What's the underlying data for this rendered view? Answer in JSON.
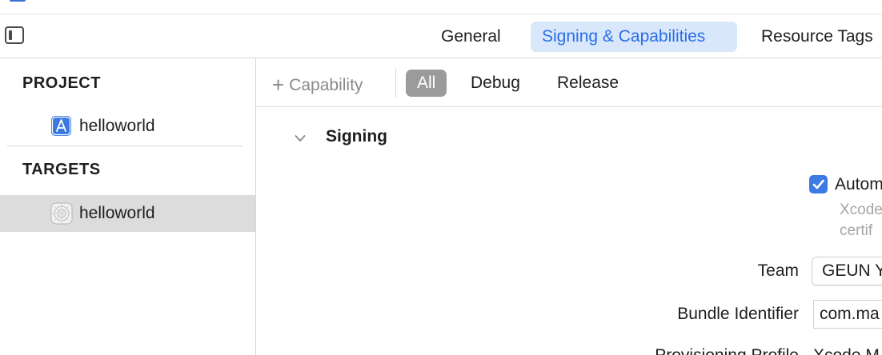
{
  "tabs": {
    "general": "General",
    "signing": "Signing & Capabilities",
    "resource_tags": "Resource Tags"
  },
  "sidebar": {
    "project_header": "PROJECT",
    "project_item": "helloworld",
    "targets_header": "TARGETS",
    "target_item": "helloworld"
  },
  "filter": {
    "add_capability": "Capability",
    "add_icon": "+",
    "all": "All",
    "debug": "Debug",
    "release": "Release"
  },
  "signing": {
    "title": "Signing",
    "automatic_label": "Autom",
    "automatic_checked": true,
    "automatic_desc": "Xcode\ncertif",
    "team_label": "Team",
    "team_value": "GEUN Y",
    "bundle_label": "Bundle Identifier",
    "bundle_value": "com.ma",
    "provisioning_label": "Provisioning Profile",
    "provisioning_value": "Xcode M"
  },
  "colors": {
    "accent": "#2a6ee8",
    "selected_tab_bg": "#d9e7fb",
    "segment_selected_bg": "#9b9b9b",
    "sidebar_selected_bg": "#dcdcdc"
  }
}
